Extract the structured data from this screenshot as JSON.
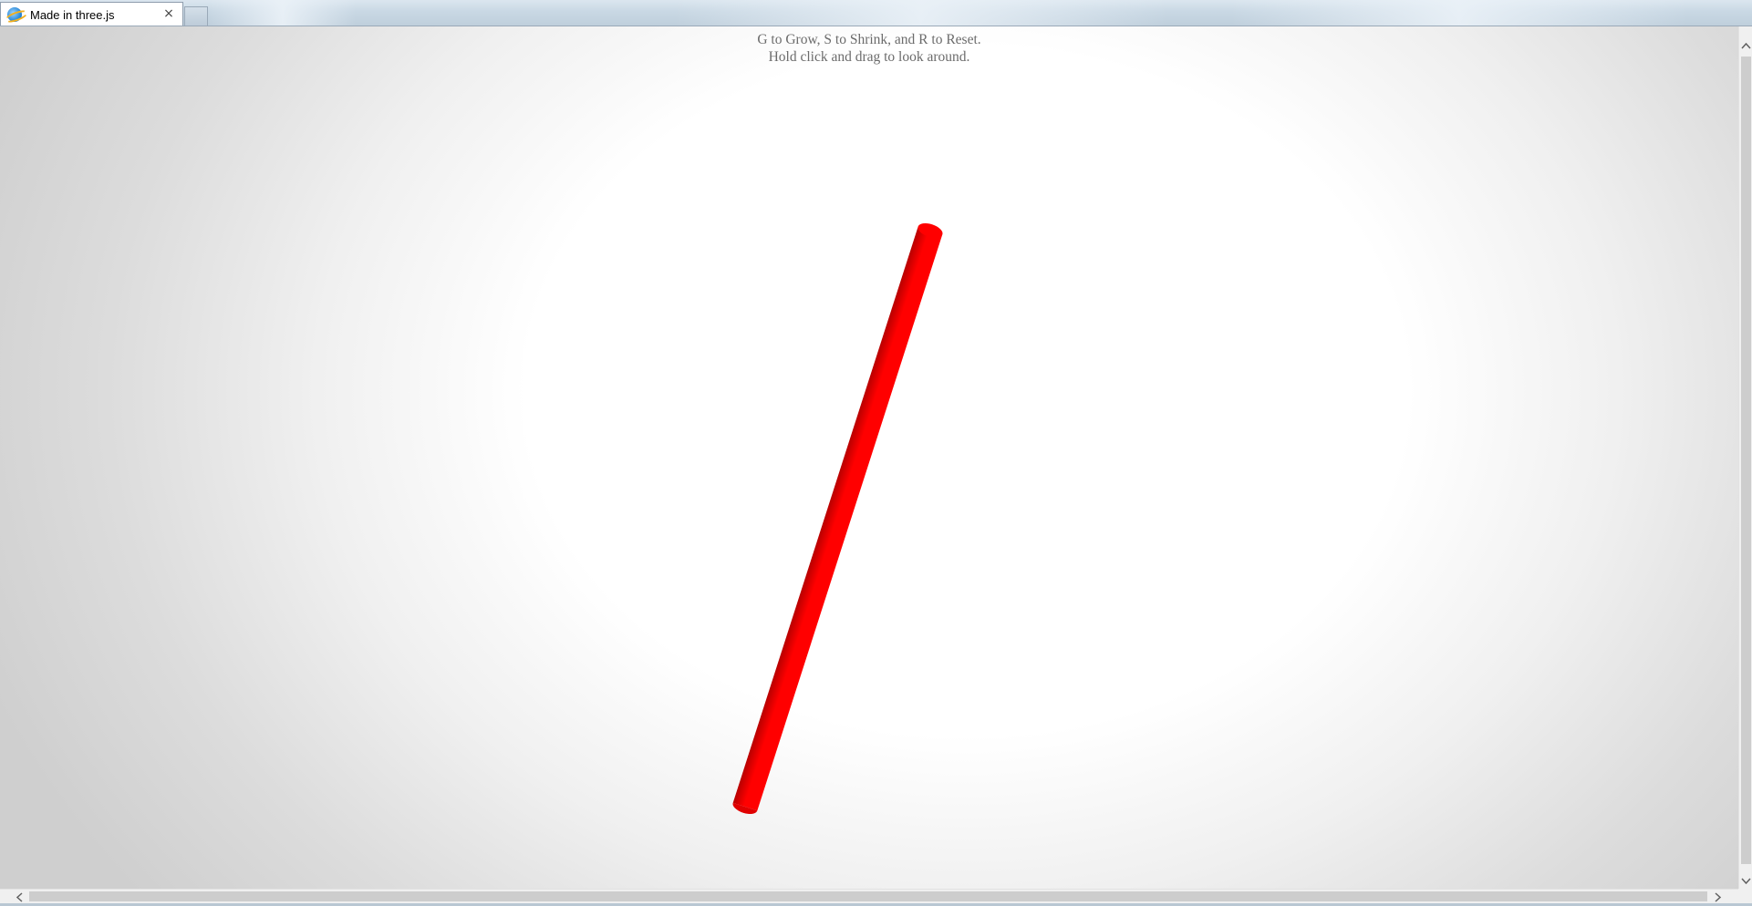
{
  "tab": {
    "title": "Made in three.js",
    "favicon_icon": "internet-explorer-icon",
    "close_icon": "close-icon",
    "close_glyph": "×"
  },
  "info": {
    "line1": "G to Grow, S to Shrink, and R to Reset.",
    "line2": "Hold click and drag to look around."
  },
  "scene": {
    "object": "cylinder",
    "color": "#ff0000",
    "shade_color": "#b80000"
  },
  "scrollbars": {
    "up_icon": "chevron-up-icon",
    "down_icon": "chevron-down-icon",
    "left_icon": "chevron-left-icon",
    "right_icon": "chevron-right-icon"
  },
  "colors": {
    "text": "#6b6b6b",
    "scrollbar_track": "#f0f0f0",
    "scrollbar_thumb": "#cdcdcd"
  }
}
